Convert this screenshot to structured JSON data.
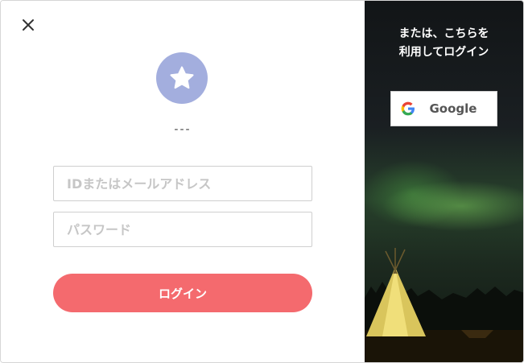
{
  "modal": {
    "close_icon": "close-icon",
    "avatar_icon": "star-icon",
    "avatar_color": "#a3aede",
    "username": "---",
    "id_placeholder": "IDまたはメールアドレス",
    "password_placeholder": "パスワード",
    "login_label": "ログイン",
    "login_color": "#f46a6e"
  },
  "alt_login": {
    "heading_line1": "または、こちらを",
    "heading_line2": "利用してログイン",
    "google_label": "Google",
    "google_icon": "google-icon"
  }
}
